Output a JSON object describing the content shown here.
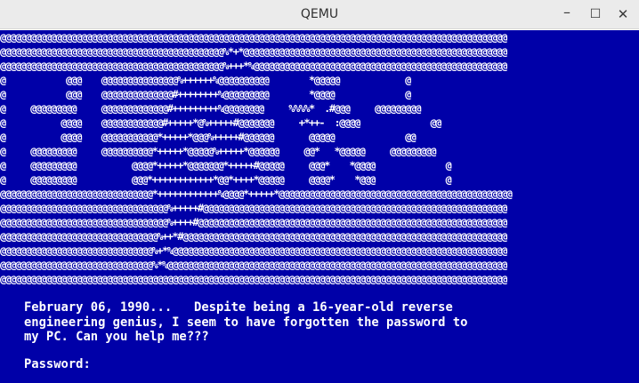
{
  "window": {
    "title": "QEMU",
    "minimize_symbol": "–",
    "maximize_symbol": "☐",
    "close_symbol": "✕"
  },
  "terminal": {
    "art": "@@@@@@@@@@@@@@@@@@@@@@@@@@@@@@@@@@@@@@@@@@@@@@@@@@@@@@@@@@@@@@@@@@@@@@@@@@@@@@@@@@@@@@@@@@@@@@@@@@@@\n@@@@@@@@@@@@@@@@@@@@@@@@@@@@@@@@@@@@@@@@@@@@%*+*@@@@@@@@@@@@@@@@@@@@@@@@@@@@@@@@@@@@@@@@@@@@@@@@@@@@\n@@@@@@@@@@@@@@@@@@@@@@@@@@@@@@@@@@@@@@@@@@@@%+++*%@@@@@@@@@@@@@@@@@@@@@@@@@@@@@@@@@@@@@@@@@@@@@@@@@@\n@            @@@    @@@@@@@@@@@@@@@%++++++%@@@@@@@@@@        *@@@@@             @\n@            @@@    @@@@@@@@@@@@@@#++++++++%@@@@@@@@@        *@@@@              @\n@     @@@@@@@@@     @@@@@@@@@@@@@#+++++++++%@@@@@@@@     %%%%*  .#@@@     @@@@@@@@@\n@           @@@@    @@@@@@@@@@@@#+++++*@%+++++#@@@@@@@     +*++-  :@@@@              @@\n@           @@@@    @@@@@@@@@@@*+++++*@@@%+++++#@@@@@@       @@@@@              @@\n@     @@@@@@@@@     @@@@@@@@@@*+++++*@@@@@%+++++*@@@@@@     @@*   *@@@@@     @@@@@@@@@\n@     @@@@@@@@@           @@@@*+++++*@@@@@@@*+++++#@@@@@     @@@*    *@@@@              @\n@     @@@@@@@@@           @@@*++++++++++++*@@*++++*@@@@@     @@@@*    *@@@              @\n@@@@@@@@@@@@@@@@@@@@@@@@@@@@@@*++++++++++++%@@@@*+++++*@@@@@@@@@@@@@@@@@@@@@@@@@@@@@@@@@@@@@@@@@@@@@@\n@@@@@@@@@@@@@@@@@@@@@@@@@@@@@@@@@%+++++#@@@@@@@@@@@@@@@@@@@@@@@@@@@@@@@@@@@@@@@@@@@@@@@@@@@@@@@@@@@@\n@@@@@@@@@@@@@@@@@@@@@@@@@@@@@@@@@%++++#@@@@@@@@@@@@@@@@@@@@@@@@@@@@@@@@@@@@@@@@@@@@@@@@@@@@@@@@@@@@@\n@@@@@@@@@@@@@@@@@@@@@@@@@@@@@@@%++*#@@@@@@@@@@@@@@@@@@@@@@@@@@@@@@@@@@@@@@@@@@@@@@@@@@@@@@@@@@@@@@@@\n@@@@@@@@@@@@@@@@@@@@@@@@@@@@@@%+*%@@@@@@@@@@@@@@@@@@@@@@@@@@@@@@@@@@@@@@@@@@@@@@@@@@@@@@@@@@@@@@@@@@\n@@@@@@@@@@@@@@@@@@@@@@@@@@@@@@%*%@@@@@@@@@@@@@@@@@@@@@@@@@@@@@@@@@@@@@@@@@@@@@@@@@@@@@@@@@@@@@@@@@@@\n@@@@@@@@@@@@@@@@@@@@@@@@@@@@@@@@@@@@@@@@@@@@@@@@@@@@@@@@@@@@@@@@@@@@@@@@@@@@@@@@@@@@@@@@@@@@@@@@@@@@",
    "message": "February 06, 1990...   Despite being a 16-year-old reverse\nengineering genius, I seem to have forgotten the password to\nmy PC. Can you help me???",
    "password_prompt": "Password:"
  },
  "colors": {
    "screen_background": "#0000a8",
    "text": "#ffffff",
    "titlebar": "#ebebeb"
  }
}
